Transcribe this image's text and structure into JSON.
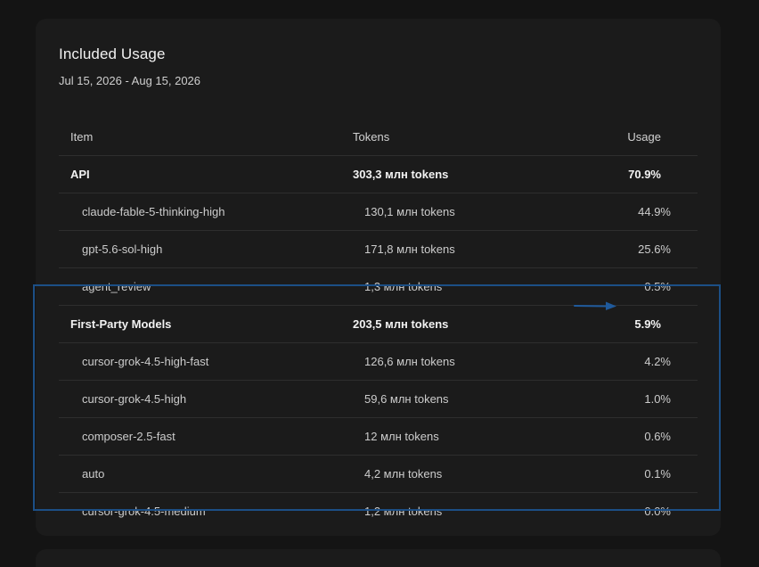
{
  "card": {
    "title": "Included Usage",
    "date_range": "Jul 15, 2026 - Aug 15, 2026"
  },
  "table": {
    "headers": {
      "item": "Item",
      "tokens": "Tokens",
      "usage": "Usage"
    },
    "rows": [
      {
        "item": "API",
        "tokens": "303,3 млн tokens",
        "usage": "70.9%"
      },
      {
        "item": "claude-fable-5-thinking-high",
        "tokens": "130,1 млн tokens",
        "usage": "44.9%"
      },
      {
        "item": "gpt-5.6-sol-high",
        "tokens": "171,8 млн tokens",
        "usage": "25.6%"
      },
      {
        "item": "agent_review",
        "tokens": "1,3 млн tokens",
        "usage": "0.5%"
      },
      {
        "item": "First-Party Models",
        "tokens": "203,5 млн tokens",
        "usage": "5.9%"
      },
      {
        "item": "cursor-grok-4.5-high-fast",
        "tokens": "126,6 млн tokens",
        "usage": "4.2%"
      },
      {
        "item": "cursor-grok-4.5-high",
        "tokens": "59,6 млн tokens",
        "usage": "1.0%"
      },
      {
        "item": "composer-2.5-fast",
        "tokens": "12 млн tokens",
        "usage": "0.6%"
      },
      {
        "item": "auto",
        "tokens": "4,2 млн tokens",
        "usage": "0.1%"
      },
      {
        "item": "cursor-grok-4.5-medium",
        "tokens": "1,2 млн tokens",
        "usage": "0.0%"
      }
    ]
  },
  "colors": {
    "highlight": "#1c4f86",
    "arrow": "#1f5a9c"
  },
  "icons": {
    "annotation_arrow": "arrow-right-icon"
  }
}
